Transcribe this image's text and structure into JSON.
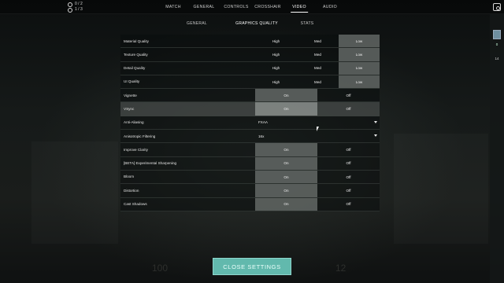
{
  "party": {
    "line1": "0 / 2",
    "line2": "1 / 3"
  },
  "main_tabs": [
    {
      "label": "MATCH"
    },
    {
      "label": "GENERAL"
    },
    {
      "label": "CONTROLS"
    },
    {
      "label": "CROSSHAIR"
    },
    {
      "label": "VIDEO",
      "active": true
    },
    {
      "label": "AUDIO"
    }
  ],
  "side_panel": {
    "level": "0",
    "count": "14"
  },
  "sub_tabs": [
    {
      "label": "GENERAL"
    },
    {
      "label": "GRAPHICS QUALITY",
      "active": true
    },
    {
      "label": "STATS"
    }
  ],
  "settings": [
    {
      "label": "Material Quality",
      "type": "triple",
      "options": [
        "High",
        "Med",
        "Low"
      ],
      "selected": 2
    },
    {
      "label": "Texture Quality",
      "type": "triple",
      "options": [
        "High",
        "Med",
        "Low"
      ],
      "selected": 2
    },
    {
      "label": "Detail Quality",
      "type": "triple",
      "options": [
        "High",
        "Med",
        "Low"
      ],
      "selected": 2
    },
    {
      "label": "UI Quality",
      "type": "triple",
      "options": [
        "High",
        "Med",
        "Low"
      ],
      "selected": 2
    },
    {
      "label": "Vignette",
      "type": "toggle",
      "options": [
        "On",
        "Off"
      ],
      "selected": 0
    },
    {
      "label": "VSync",
      "type": "toggle",
      "options": [
        "On",
        "Off"
      ],
      "selected": 0,
      "highlight": true
    },
    {
      "label": "Anti-Aliasing",
      "type": "dropdown",
      "value": "FXAA"
    },
    {
      "label": "Anisotropic Filtering",
      "type": "dropdown",
      "value": "16x"
    },
    {
      "label": "Improve Clarity",
      "type": "toggle",
      "options": [
        "On",
        "Off"
      ],
      "selected": 0
    },
    {
      "label": "[BETA] Experimental Sharpening",
      "type": "toggle",
      "options": [
        "On",
        "Off"
      ],
      "selected": 0
    },
    {
      "label": "Bloom",
      "type": "toggle",
      "options": [
        "On",
        "Off"
      ],
      "selected": 0
    },
    {
      "label": "Distortion",
      "type": "toggle",
      "options": [
        "On",
        "Off"
      ],
      "selected": 0
    },
    {
      "label": "Cast Shadows",
      "type": "toggle",
      "options": [
        "On",
        "Off"
      ],
      "selected": 0
    }
  ],
  "close_button": {
    "label": "CLOSE SETTINGS"
  },
  "colors": {
    "accent": "#62b9ad",
    "selected_option": "#6e7370"
  },
  "background_text": {
    "left_number": "100",
    "right_number": "12"
  }
}
